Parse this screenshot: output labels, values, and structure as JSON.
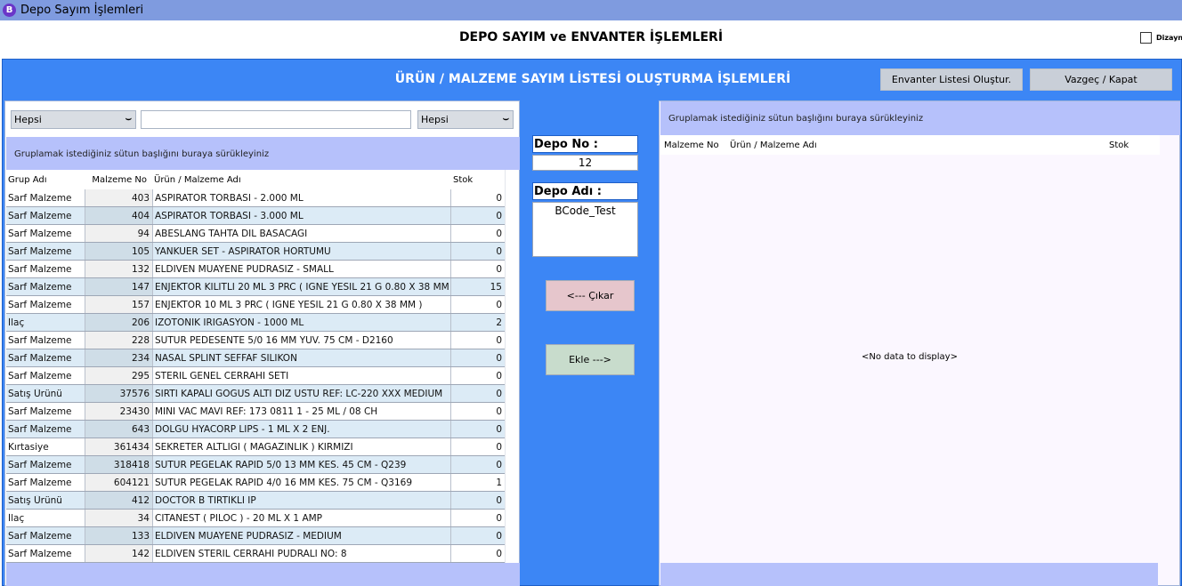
{
  "window": {
    "app_icon_letter": "B",
    "title": "Depo Sayım İşlemleri"
  },
  "header": {
    "title": "DEPO SAYIM ve ENVANTER İŞLEMLERİ",
    "dizayn_label": "Dizayn"
  },
  "main": {
    "title": "ÜRÜN / MALZEME SAYIM LİSTESİ OLUŞTURMA İŞLEMLERİ",
    "create_button": "Envanter Listesi Oluştur.",
    "close_button": "Vazgeç / Kapat"
  },
  "left": {
    "filter1": {
      "value": "Hepsi"
    },
    "search": {
      "value": ""
    },
    "filter2": {
      "value": "Hepsi"
    },
    "group_hint": "Gruplamak istediğiniz sütun başlığını buraya sürükleyiniz",
    "columns": {
      "group": "Grup Adı",
      "no": "Malzeme No",
      "name": "Ürün / Malzeme Adı",
      "stock": "Stok"
    },
    "rows": [
      {
        "group": "Sarf Malzeme",
        "no": "403",
        "name": "ASPIRATOR TORBASI - 2.000 ML",
        "stock": "0"
      },
      {
        "group": "Sarf Malzeme",
        "no": "404",
        "name": "ASPIRATOR TORBASI - 3.000 ML",
        "stock": "0"
      },
      {
        "group": "Sarf Malzeme",
        "no": "94",
        "name": "ABESLANG TAHTA DIL BASACAGI",
        "stock": "0"
      },
      {
        "group": "Sarf Malzeme",
        "no": "105",
        "name": "YANKUER SET - ASPIRATOR HORTUMU",
        "stock": "0"
      },
      {
        "group": "Sarf Malzeme",
        "no": "132",
        "name": "ELDIVEN MUAYENE PUDRASIZ - SMALL",
        "stock": "0"
      },
      {
        "group": "Sarf Malzeme",
        "no": "147",
        "name": "ENJEKTOR KILITLI 20 ML 3 PRC ( IGNE YESIL 21 G 0.80 X 38 MM",
        "stock": "15"
      },
      {
        "group": "Sarf Malzeme",
        "no": "157",
        "name": "ENJEKTOR 10 ML 3 PRC ( IGNE YESIL 21 G 0.80 X 38 MM )",
        "stock": "0"
      },
      {
        "group": "İlaç",
        "no": "206",
        "name": "IZOTONIK IRIGASYON - 1000 ML",
        "stock": "2"
      },
      {
        "group": "Sarf Malzeme",
        "no": "228",
        "name": "SUTUR PEDESENTE 5/0 16 MM YUV. 75 CM - D2160",
        "stock": "0"
      },
      {
        "group": "Sarf Malzeme",
        "no": "234",
        "name": "NASAL SPLINT SEFFAF SILIKON",
        "stock": "0"
      },
      {
        "group": "Sarf Malzeme",
        "no": "295",
        "name": "STERIL GENEL CERRAHI SETI",
        "stock": "0"
      },
      {
        "group": "Satış Ürünü",
        "no": "37576",
        "name": "SIRTI KAPALI GOGUS ALTI DIZ USTU REF: LC-220 XXX MEDIUM",
        "stock": "0"
      },
      {
        "group": "Sarf Malzeme",
        "no": "23430",
        "name": "MINI VAC MAVI REF: 173 0811 1 - 25 ML / 08 CH",
        "stock": "0"
      },
      {
        "group": "Sarf Malzeme",
        "no": "643",
        "name": "DOLGU HYACORP LIPS - 1 ML X 2 ENJ.",
        "stock": "0"
      },
      {
        "group": "Kırtasiye",
        "no": "361434",
        "name": "SEKRETER ALTLIGI ( MAGAZINLIK ) KIRMIZI",
        "stock": "0"
      },
      {
        "group": "Sarf Malzeme",
        "no": "318418",
        "name": "SUTUR PEGELAK RAPID 5/0 13 MM KES. 45 CM - Q239",
        "stock": "0"
      },
      {
        "group": "Sarf Malzeme",
        "no": "604121",
        "name": "SUTUR PEGELAK RAPID 4/0 16 MM KES. 75 CM - Q3169",
        "stock": "1"
      },
      {
        "group": "Satış Ürünü",
        "no": "412",
        "name": "DOCTOR B TIRTIKLI IP",
        "stock": "0"
      },
      {
        "group": "İlaç",
        "no": "34",
        "name": "CITANEST ( PILOC ) - 20 ML X 1 AMP",
        "stock": "0"
      },
      {
        "group": "Sarf Malzeme",
        "no": "133",
        "name": "ELDIVEN MUAYENE PUDRASIZ - MEDIUM",
        "stock": "0"
      },
      {
        "group": "Sarf Malzeme",
        "no": "142",
        "name": "ELDIVEN STERIL CERRAHI PUDRALI NO: 8",
        "stock": "0"
      }
    ]
  },
  "middle": {
    "depo_no_label": "Depo No :",
    "depo_no_value": "12",
    "depo_adi_label": "Depo Adı :",
    "depo_adi_value": "BCode_Test",
    "remove_button": "<--- Çıkar",
    "add_button": "Ekle --->"
  },
  "right": {
    "group_hint": "Gruplamak istediğiniz sütun başlığını buraya sürükleyiniz",
    "columns": {
      "no": "Malzeme No",
      "name": "Ürün / Malzeme Adı",
      "stock": "Stok"
    },
    "empty_text": "<No data to display>"
  },
  "colors": {
    "titlebar": "#7f9bdf",
    "frame_blue": "#3c86f5",
    "group_bar": "#b6c1fb",
    "row_alt": "#dcebf6",
    "remove_button": "#e6c6cc",
    "add_button": "#c8dccc"
  }
}
